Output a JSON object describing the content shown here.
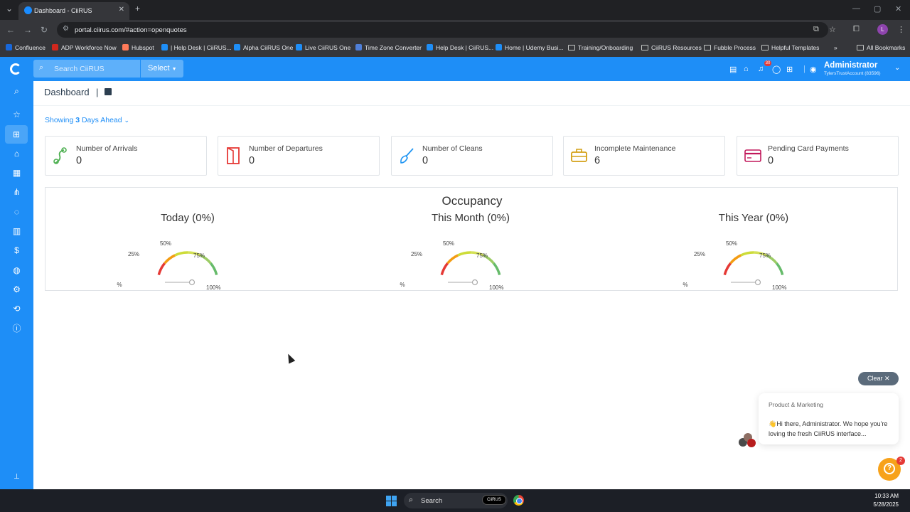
{
  "browser": {
    "tab_title": "Dashboard - CiiRUS",
    "url": "portal.ciirus.com/#action=openquotes",
    "bookmarks": [
      {
        "label": "Confluence",
        "color": "#1868db"
      },
      {
        "label": "ADP Workforce Now",
        "color": "#d0271d"
      },
      {
        "label": "Hubspot",
        "color": "#ff7a59"
      },
      {
        "label": "| Help Desk | CiiRUS...",
        "color": "#1e8ef7"
      },
      {
        "label": "Alpha CiiRUS One",
        "color": "#1e8ef7"
      },
      {
        "label": "Live CiiRUS One",
        "color": "#1e8ef7"
      },
      {
        "label": "Time Zone Converter",
        "color": "#4f7fd8"
      },
      {
        "label": "Help Desk | CiiRUS...",
        "color": "#1e8ef7"
      },
      {
        "label": "Home | Udemy Busi...",
        "color": "#1e8ef7"
      },
      {
        "label": "Training/Onboarding",
        "folder": true
      },
      {
        "label": "CiiRUS Resources",
        "folder": true
      },
      {
        "label": "Fubble Process",
        "folder": true
      },
      {
        "label": "Helpful Templates",
        "folder": true
      }
    ],
    "all_bookmarks": "All Bookmarks",
    "profile_initial": "L"
  },
  "header": {
    "search_placeholder": "Search CiiRUS",
    "select_label": "Select",
    "notification_count": "30",
    "user_name": "Administrator",
    "account": "TylersTrustAccount (83596)"
  },
  "sidebar": {
    "icons": [
      "search-icon",
      "star-icon",
      "dashboard-icon",
      "home-icon",
      "calendar-icon",
      "share-icon",
      "chat-icon",
      "building-icon",
      "dollar-icon",
      "globe-icon",
      "gear-icon",
      "integration-icon",
      "info-icon"
    ],
    "active": "dashboard-icon"
  },
  "dashboard": {
    "title": "Dashboard",
    "separator": "|",
    "showing_prefix": "Showing",
    "showing_days": "3",
    "showing_suffix": "Days Ahead",
    "cards": [
      {
        "label": "Number of Arrivals",
        "value": "0",
        "icon": "arrivals-icon",
        "color": "#4caf50"
      },
      {
        "label": "Number of Departures",
        "value": "0",
        "icon": "departures-icon",
        "color": "#e53935"
      },
      {
        "label": "Number of Cleans",
        "value": "0",
        "icon": "cleans-icon",
        "color": "#2196f3"
      },
      {
        "label": "Incomplete Maintenance",
        "value": "6",
        "icon": "maintenance-icon",
        "color": "#d4a017"
      },
      {
        "label": "Pending Card Payments",
        "value": "0",
        "icon": "card-payments-icon",
        "color": "#c2185b"
      }
    ],
    "occupancy": {
      "title": "Occupancy",
      "gauges": [
        {
          "title": "Today (0%)",
          "value": 0
        },
        {
          "title": "This Month (0%)",
          "value": 0
        },
        {
          "title": "This Year (0%)",
          "value": 0
        }
      ],
      "scale_labels": [
        "0%",
        "25%",
        "50%",
        "75%",
        "100%"
      ]
    }
  },
  "chat": {
    "clear_label": "Clear",
    "team": "Product & Marketing",
    "message": "👋Hi there, Administrator. We hope you're loving the fresh CiiRUS interface...",
    "badge": "2"
  },
  "taskbar": {
    "search": "Search",
    "app_label": "CiiRUS",
    "time": "10:33 AM",
    "date": "5/28/2025"
  }
}
